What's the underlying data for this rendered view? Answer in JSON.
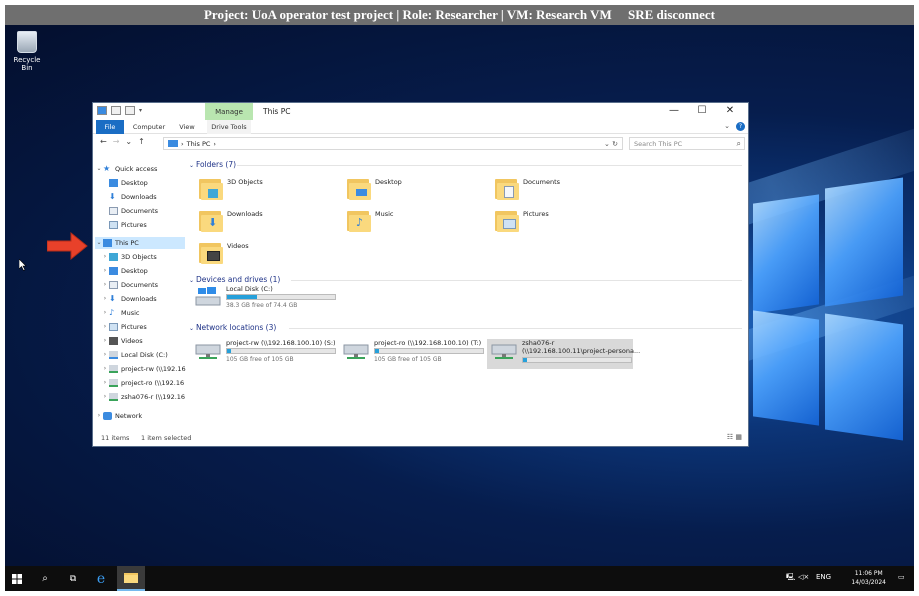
{
  "session_bar": {
    "text": "Project: UoA operator test project | Role: Researcher | VM: Research VM     SRE disconnect"
  },
  "desktop": {
    "recycle_bin_label": "Recycle Bin"
  },
  "explorer": {
    "title": "This PC",
    "manage_label": "Manage",
    "tabs": {
      "file": "File",
      "computer": "Computer",
      "view": "View",
      "drive_tools": "Drive Tools"
    },
    "window_controls": {
      "minimize": "—",
      "maximize": "☐",
      "close": "✕"
    },
    "nav_buttons": {
      "back": "←",
      "forward": "→",
      "recent": "⌄",
      "up": "↑"
    },
    "address": {
      "path": "This PC",
      "separator": "›"
    },
    "search": {
      "placeholder": "Search This PC"
    },
    "nav_pane": {
      "quick_access": "Quick access",
      "quick_items": [
        "Desktop",
        "Downloads",
        "Documents",
        "Pictures"
      ],
      "this_pc": "This PC",
      "pc_items": [
        "3D Objects",
        "Desktop",
        "Documents",
        "Downloads",
        "Music",
        "Pictures",
        "Videos",
        "Local Disk (C:)",
        "project-rw (\\\\192.16",
        "project-ro (\\\\192.16",
        "zsha076-r (\\\\192.16"
      ],
      "network": "Network"
    },
    "folders_header": "Folders (7)",
    "folders": [
      "3D Objects",
      "Desktop",
      "Documents",
      "Downloads",
      "Music",
      "Pictures",
      "Videos"
    ],
    "devices_header": "Devices and drives (1)",
    "local_disk": {
      "name": "Local Disk (C:)",
      "free": "38.3 GB free of 74.4 GB",
      "used_fraction": 0.28
    },
    "network_header": "Network locations (3)",
    "network_drives": [
      {
        "name": "project-rw (\\\\192.168.100.10) (S:)",
        "free": "105 GB free of 105 GB",
        "used_fraction": 0.04
      },
      {
        "name": "project-ro (\\\\192.168.100.10) (T:)",
        "free": "105 GB free of 105 GB",
        "used_fraction": 0.04
      },
      {
        "name": "zsha076-r",
        "path": "(\\\\192.168.100.11\\project-persona...",
        "used_fraction": 0.04
      }
    ],
    "status": {
      "items": "11 items",
      "selected": "1 item selected"
    }
  },
  "taskbar": {
    "language": "ENG",
    "time": "11:06 PM",
    "date": "14/03/2024"
  },
  "colors": {
    "accent": "#1a6dc4",
    "drive_fill": "#26a0da",
    "arrow": "#e8412a"
  }
}
